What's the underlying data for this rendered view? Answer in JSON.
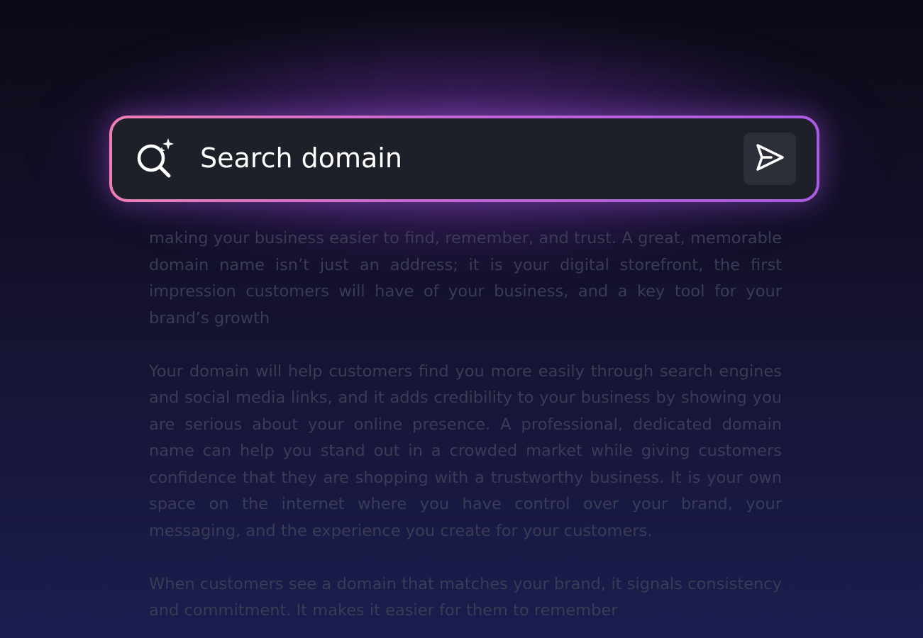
{
  "search": {
    "placeholder": "Search domain",
    "search_icon": "search-sparkle-icon",
    "send_icon": "send-icon"
  },
  "article": {
    "paragraphs": [
      "making your business easier to find, remember, and trust. A great, memorable domain name isn’t just an address; it is your digital storefront, the first impression customers will have of your business, and a key tool for your brand’s growth",
      "Your domain will help customers find you more easily through search engines and social media links, and it adds credibility to your business by showing you are serious about your online presence. A professional, dedicated domain name can help you stand out in a crowded market while giving customers confidence that they are shopping with a trustworthy business. It is your own space on the internet where you have control over your brand, your messaging, and the experience you create for your customers.",
      "When customers see a domain that matches your brand, it signals consistency and commitment. It makes it easier for them to remember"
    ]
  },
  "colors": {
    "border_start": "#ee7fb3",
    "border_end": "#a95ce0",
    "bar_bg": "#1e2029",
    "send_bg": "#2c2e38",
    "body_text": "#3a3c55"
  }
}
